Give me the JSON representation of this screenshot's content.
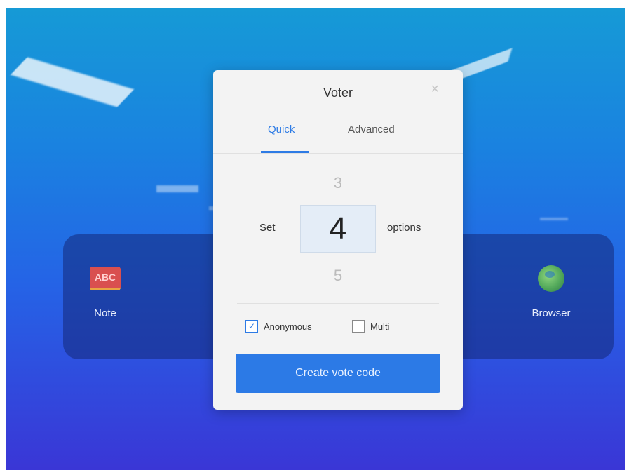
{
  "desktop": {
    "apps": [
      {
        "label": "Note",
        "icon": "abc-note-icon",
        "icon_text": "ABC"
      },
      {
        "label": "Browser",
        "icon": "globe-browser-icon"
      }
    ]
  },
  "dialog": {
    "title": "Voter",
    "close_icon": "close-icon",
    "close_glyph": "×",
    "tabs": [
      {
        "label": "Quick",
        "active": true
      },
      {
        "label": "Advanced",
        "active": false
      }
    ],
    "picker": {
      "prefix": "Set",
      "suffix": "options",
      "previous": "3",
      "current": "4",
      "next": "5"
    },
    "options": {
      "anonymous": {
        "label": "Anonymous",
        "checked": true,
        "glyph": "✓"
      },
      "multi": {
        "label": "Multi",
        "checked": false
      }
    },
    "create_button": "Create vote code"
  },
  "colors": {
    "accent": "#2c7ae6",
    "dialog_bg": "#f3f3f3"
  }
}
